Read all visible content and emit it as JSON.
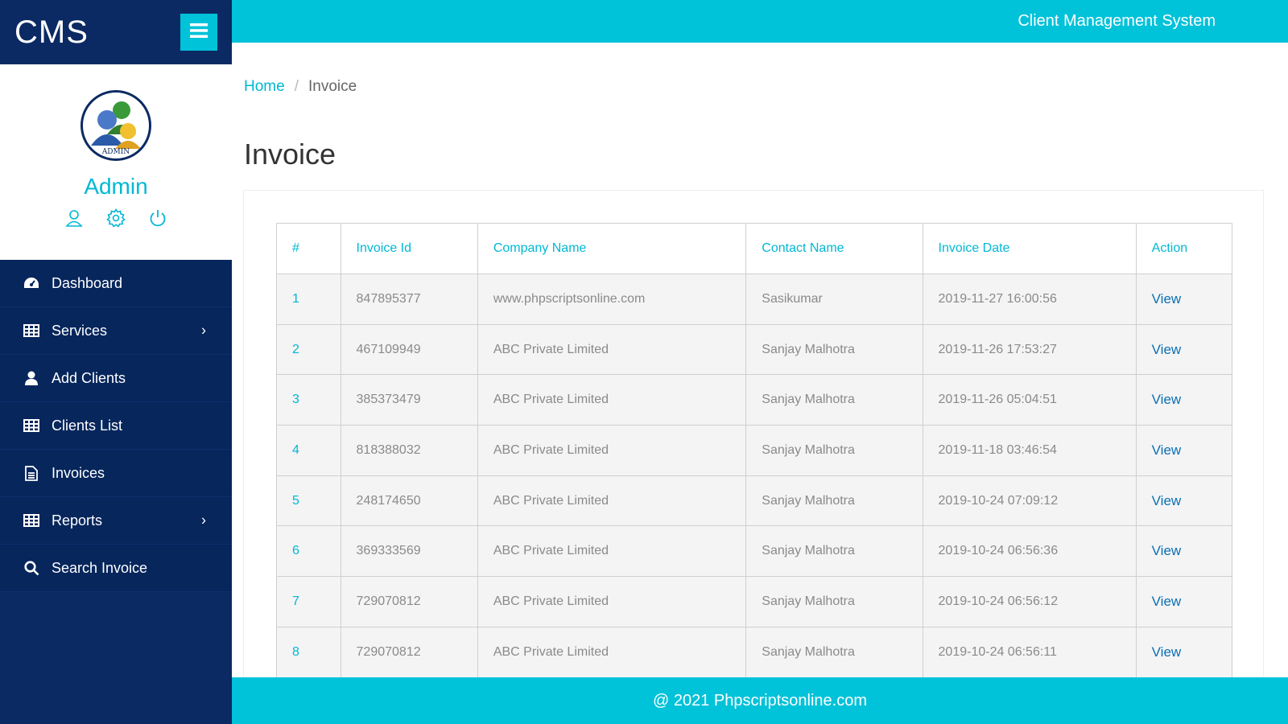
{
  "brand": {
    "name": "CMS"
  },
  "profile": {
    "name": "Admin",
    "avatar_label": "ADMIN"
  },
  "icons": {
    "menu_toggle": "hamburger-icon",
    "profile_user": "user-icon",
    "profile_settings": "gear-icon",
    "profile_logout": "power-icon"
  },
  "sidebar": {
    "items": [
      {
        "label": "Dashboard",
        "icon": "dashboard-icon",
        "has_submenu": false
      },
      {
        "label": "Services",
        "icon": "table-icon",
        "has_submenu": true
      },
      {
        "label": "Add Clients",
        "icon": "user-icon",
        "has_submenu": false
      },
      {
        "label": "Clients List",
        "icon": "table-icon",
        "has_submenu": false
      },
      {
        "label": "Invoices",
        "icon": "file-icon",
        "has_submenu": false
      },
      {
        "label": "Reports",
        "icon": "table-icon",
        "has_submenu": true
      },
      {
        "label": "Search Invoice",
        "icon": "search-icon",
        "has_submenu": false
      }
    ]
  },
  "header": {
    "title": "Client Management System"
  },
  "breadcrumb": {
    "home": "Home",
    "separator": "/",
    "current": "Invoice"
  },
  "page": {
    "title": "Invoice"
  },
  "table": {
    "columns": [
      "#",
      "Invoice Id",
      "Company Name",
      "Contact Name",
      "Invoice Date",
      "Action"
    ],
    "rows": [
      {
        "num": "1",
        "invoice_id": "847895377",
        "company": "www.phpscriptsonline.com",
        "contact": "Sasikumar",
        "date": "2019-11-27 16:00:56",
        "action": "View"
      },
      {
        "num": "2",
        "invoice_id": "467109949",
        "company": "ABC Private Limited",
        "contact": "Sanjay Malhotra",
        "date": "2019-11-26 17:53:27",
        "action": "View"
      },
      {
        "num": "3",
        "invoice_id": "385373479",
        "company": "ABC Private Limited",
        "contact": "Sanjay Malhotra",
        "date": "2019-11-26 05:04:51",
        "action": "View"
      },
      {
        "num": "4",
        "invoice_id": "818388032",
        "company": "ABC Private Limited",
        "contact": "Sanjay Malhotra",
        "date": "2019-11-18 03:46:54",
        "action": "View"
      },
      {
        "num": "5",
        "invoice_id": "248174650",
        "company": "ABC Private Limited",
        "contact": "Sanjay Malhotra",
        "date": "2019-10-24 07:09:12",
        "action": "View"
      },
      {
        "num": "6",
        "invoice_id": "369333569",
        "company": "ABC Private Limited",
        "contact": "Sanjay Malhotra",
        "date": "2019-10-24 06:56:36",
        "action": "View"
      },
      {
        "num": "7",
        "invoice_id": "729070812",
        "company": "ABC Private Limited",
        "contact": "Sanjay Malhotra",
        "date": "2019-10-24 06:56:12",
        "action": "View"
      },
      {
        "num": "8",
        "invoice_id": "729070812",
        "company": "ABC Private Limited",
        "contact": "Sanjay Malhotra",
        "date": "2019-10-24 06:56:11",
        "action": "View"
      }
    ]
  },
  "footer": {
    "text": "@ 2021 Phpscriptsonline.com"
  },
  "colors": {
    "navy": "#0b2a63",
    "accent": "#00c2d9",
    "link": "#0a6fb5"
  }
}
